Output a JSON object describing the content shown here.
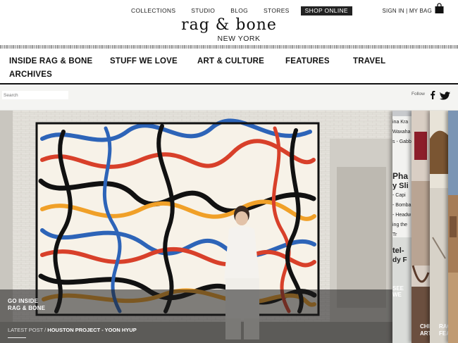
{
  "top_nav": {
    "links": [
      "COLLECTIONS",
      "STUDIO",
      "BLOG",
      "STORES",
      "SHOP ONLINE"
    ],
    "active": "SHOP ONLINE",
    "account": "SIGN IN | MY BAG"
  },
  "logo": {
    "name": "rag & bone",
    "city": "NEW YORK"
  },
  "section_nav": {
    "row1": [
      "INSIDE RAG & BONE",
      "STUFF WE LOVE",
      "ART & CULTURE",
      "FEATURES",
      "TRAVEL"
    ],
    "row2": [
      "ARCHIVES"
    ]
  },
  "search": {
    "placeholder": "Search"
  },
  "social": {
    "follow_label": "Follow",
    "icons": [
      "facebook-icon",
      "twitter-icon"
    ]
  },
  "hero": {
    "go_inside_line1": "GO INSIDE",
    "go_inside_line2": "RAG & BONE",
    "latest_label": "LATEST POST /",
    "latest_title": "HOUSTON PROJECT - YOON HYUP"
  },
  "slides": {
    "slide1_text": [
      "ina Kra",
      "Waxaha",
      "s - Gabb",
      "Pha",
      "y Sli",
      "- Capi",
      "- Bomba",
      "- Headw",
      "ing the Tr",
      "tel-",
      "dy F"
    ],
    "slide2_label": [
      "SEE",
      "WE"
    ],
    "slide3_label": [
      "CHI",
      "ART"
    ],
    "slide4_label": [
      "RAG",
      "FEA"
    ]
  },
  "colors": {
    "accent_dark": "#222222",
    "mural_red": "#d8402a",
    "mural_blue": "#2d64b8",
    "mural_orange": "#f0a028"
  }
}
